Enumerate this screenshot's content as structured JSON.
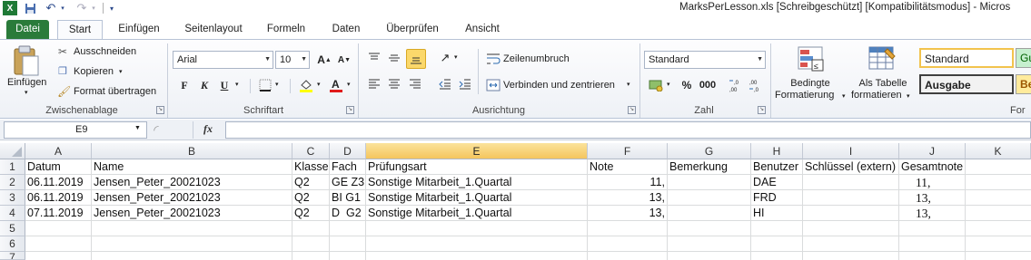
{
  "window": {
    "title": "MarksPerLesson.xls  [Schreibgeschützt]  [Kompatibilitätsmodus]  -  Micros"
  },
  "tabs": [
    "Datei",
    "Start",
    "Einfügen",
    "Seitenlayout",
    "Formeln",
    "Daten",
    "Überprüfen",
    "Ansicht"
  ],
  "ribbon": {
    "clipboard": {
      "paste": "Einfügen",
      "cut": "Ausschneiden",
      "copy": "Kopieren",
      "format_painter": "Format übertragen",
      "label": "Zwischenablage"
    },
    "font": {
      "name": "Arial",
      "size": "10",
      "bold": "F",
      "italic": "K",
      "underline": "U",
      "label": "Schriftart"
    },
    "alignment": {
      "wrap": "Zeilenumbruch",
      "merge": "Verbinden und zentrieren",
      "label": "Ausrichtung"
    },
    "number": {
      "format": "Standard",
      "percent": "%",
      "thousands": "000",
      "label": "Zahl"
    },
    "styles": {
      "conditional_line1": "Bedingte",
      "conditional_line2": "Formatierung",
      "table_line1": "Als Tabelle",
      "table_line2": "formatieren",
      "style_standard": "Standard",
      "style_ausgabe": "Ausgabe",
      "style_gut_partial": "Gu",
      "style_be_partial": "Be",
      "label_partial": "For"
    }
  },
  "formula_bar": {
    "name_box": "E9",
    "fx": "fx",
    "value": ""
  },
  "grid": {
    "columns": [
      "A",
      "B",
      "C",
      "D",
      "E",
      "F",
      "G",
      "H",
      "I",
      "J",
      "K"
    ],
    "selected_column": "E",
    "row_numbers": [
      "1",
      "2",
      "3",
      "4",
      "5",
      "6",
      "7"
    ],
    "rows": [
      [
        "Datum",
        "Name",
        "Klasse",
        "Fach",
        "Prüfungsart",
        "Note",
        "Bemerkung",
        "Benutzer",
        "Schlüssel (extern)",
        "Gesamtnote",
        ""
      ],
      [
        "06.11.2019",
        "Jensen_Peter_20021023",
        "Q2",
        "GE Z3",
        "Sonstige Mitarbeit_1.Quartal",
        "11,",
        "",
        "DAE",
        "",
        "11,",
        ""
      ],
      [
        "06.11.2019",
        "Jensen_Peter_20021023",
        "Q2",
        "BI G1",
        "Sonstige Mitarbeit_1.Quartal",
        "13,",
        "",
        "FRD",
        "",
        "13,",
        ""
      ],
      [
        "07.11.2019",
        "Jensen_Peter_20021023",
        "Q2",
        "D  G2",
        "Sonstige Mitarbeit_1.Quartal",
        "13,",
        "",
        "HI",
        "",
        "13,",
        ""
      ]
    ]
  },
  "colors": {
    "file_tab": "#2a7b3a",
    "selected_header": "#f5c55d",
    "accent_highlight": "#fbd86b"
  }
}
